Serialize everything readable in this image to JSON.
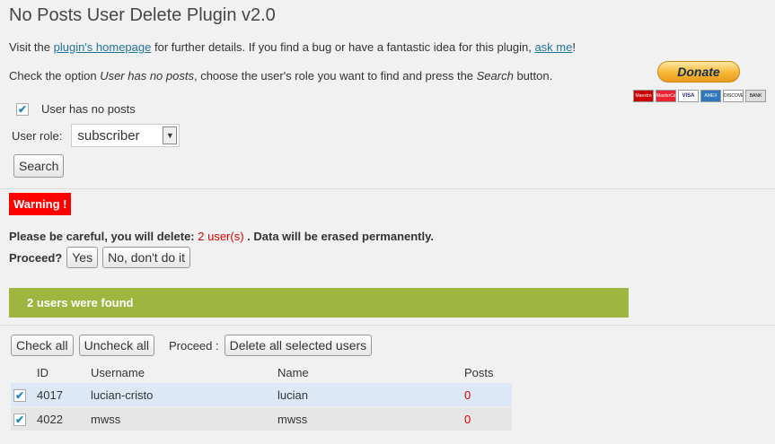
{
  "header": {
    "title": "No Posts User Delete Plugin v2.0"
  },
  "intro": {
    "prefix": "Visit the ",
    "homepage_link": "plugin's homepage",
    "middle": " for further details. If you find a bug or have a fantastic idea for this plugin, ",
    "ask_link": "ask me",
    "suffix": "!"
  },
  "instructions": {
    "part1": "Check the option ",
    "option_em": "User has no posts",
    "part2": ", choose the user's role you want to find and press the ",
    "button_em": "Search",
    "part3": " button."
  },
  "donate": {
    "label": "Donate",
    "cards": [
      "Maestro",
      "MasterCard",
      "VISA",
      "AMEX",
      "DISCOVER",
      "BANK"
    ]
  },
  "filter": {
    "no_posts_checked": true,
    "no_posts_label": "User has no posts",
    "role_label": "User role:",
    "role_value": "subscriber",
    "search_button": "Search"
  },
  "warning": {
    "badge": "Warning !",
    "careful_prefix": "Please be careful, you will delete: ",
    "count_text": "2 user(s)",
    "careful_suffix": " . Data will be erased permanently.",
    "proceed_label": "Proceed?",
    "yes_button": "Yes",
    "no_button": "No, don't do it"
  },
  "results": {
    "found_text": "2 users were found",
    "check_all": "Check all",
    "uncheck_all": "Uncheck all",
    "proceed_label": "Proceed :",
    "delete_selected": "Delete all selected users",
    "columns": [
      "ID",
      "Username",
      "Name",
      "Posts"
    ],
    "rows": [
      {
        "checked": true,
        "id": "4017",
        "username": "lucian-cristo",
        "name": "lucian",
        "posts": "0"
      },
      {
        "checked": true,
        "id": "4022",
        "username": "mwss",
        "name": "mwss",
        "posts": "0"
      }
    ]
  }
}
